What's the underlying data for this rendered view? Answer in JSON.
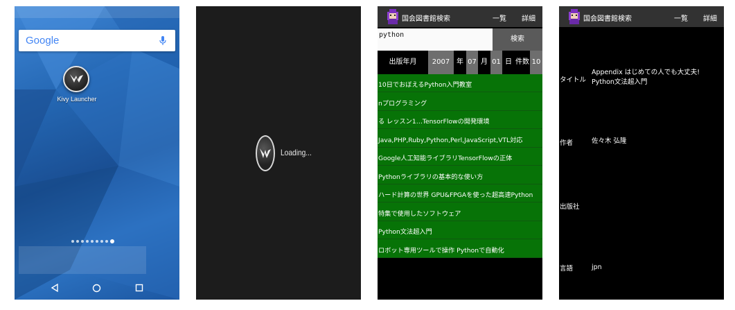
{
  "launcher": {
    "search_logo": "Google",
    "app_label": "Kivy Launcher",
    "page_count": 9,
    "active_page": 9,
    "icons": [
      "mic-icon",
      "kivy-logo-icon",
      "back-icon",
      "home-icon",
      "recents-icon"
    ]
  },
  "loading": {
    "text": "Loading..."
  },
  "search_screen": {
    "app_title": "国会図書館検索",
    "menu_list": "一覧",
    "menu_detail": "詳細",
    "query": "python",
    "search_button": "検索",
    "date_label": "出版年月",
    "year": "2007",
    "year_unit": "年",
    "month": "07",
    "month_unit": "月",
    "day": "01",
    "day_unit": "日",
    "count_label": "件数",
    "count": "10",
    "results": [
      "10日でおぼえるPython入門教室",
      "nプログラミング",
      "る レッスン1…TensorFlowの開発環境",
      "Java,PHP,Ruby,Python,Perl,JavaScript,VTL対応",
      "Google人工知能ライブラリTensorFlowの正体",
      "Pythonライブラリの基本的な使い方",
      "ハード計算の世界 GPU&FPGAを使った超高速Python",
      "特集で使用したソフトウェア",
      "Python文法超入門",
      "ロボット専用ツールで操作 Pythonで自動化"
    ],
    "colors": {
      "result_bg": "#077307",
      "appbar_bg": "#323232"
    }
  },
  "detail_screen": {
    "app_title": "国会図書館検索",
    "menu_list": "一覧",
    "menu_detail": "詳細",
    "title_label": "タイトル",
    "title_value": "Appendix はじめての人でも大丈夫! Python文法超入門",
    "author_label": "作者",
    "author_value": "佐々木 弘隆",
    "publisher_label": "出版社",
    "publisher_value": "",
    "language_label": "言語",
    "language_value": "jpn"
  }
}
